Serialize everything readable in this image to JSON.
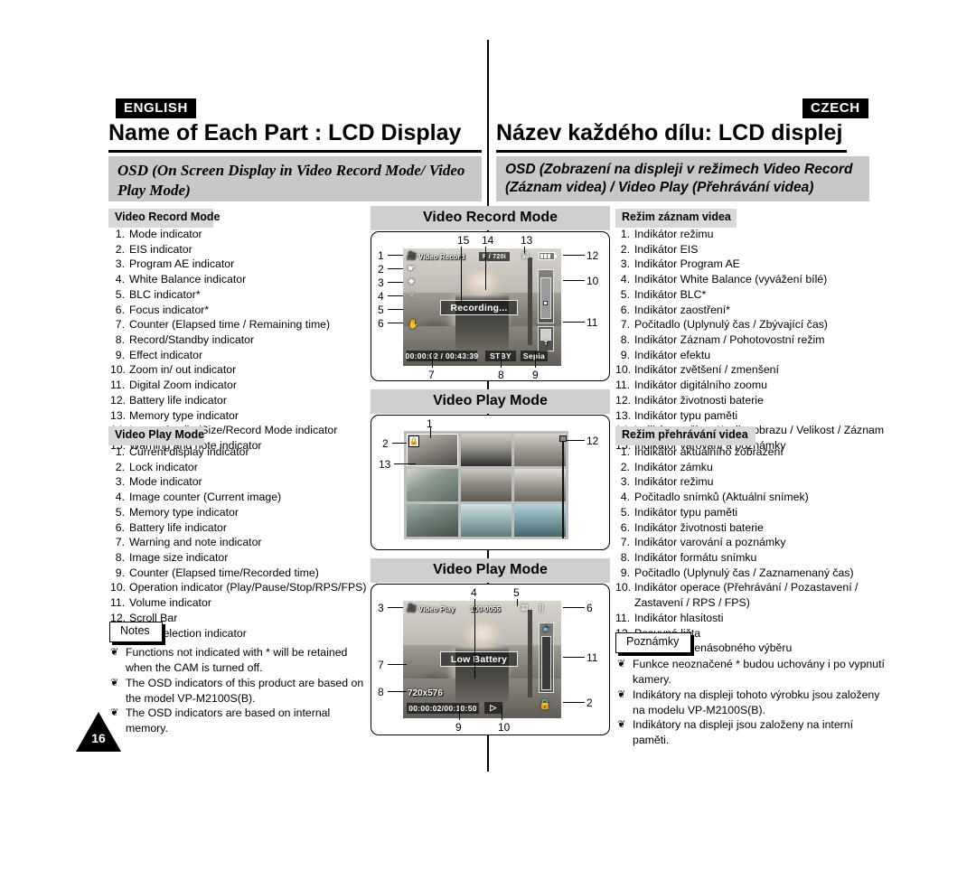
{
  "page": {
    "number": "16",
    "lang_left": "ENGLISH",
    "lang_right": "CZECH",
    "title_left": "Name of Each Part : LCD Display",
    "title_right": "Název každého dílu: LCD displej",
    "osd_subtitle_left": "OSD (On Screen Display in Video Record Mode/ Video Play Mode)",
    "osd_subtitle_right": "OSD (Zobrazení na displeji v režimech Video Record (Záznam videa) / Video Play (Přehrávání videa)"
  },
  "left": {
    "record_heading": "Video Record Mode",
    "record_items": [
      "Mode indicator",
      "EIS indicator",
      "Program AE indicator",
      "White Balance indicator",
      "BLC indicator*",
      "Focus indicator*",
      "Counter (Elapsed time / Remaining time)",
      "Record/Standby indicator",
      "Effect indicator",
      "Zoom in/ out indicator",
      "Digital Zoom indicator",
      "Battery life indicator",
      "Memory type indicator",
      "Image Quality/Size/Record Mode indicator",
      "Warning and note indicator"
    ],
    "play_heading": "Video Play Mode",
    "play_items": [
      "Current display indicator",
      "Lock indicator",
      "Mode indicator",
      "Image counter (Current image)",
      "Memory type indicator",
      "Battery life indicator",
      "Warning and note indicator",
      "Image size indicator",
      "Counter (Elapsed time/Recorded time)",
      "Operation indicator (Play/Pause/Stop/RPS/FPS)",
      "Volume indicator",
      "Scroll Bar",
      "Multi Selection indicator"
    ],
    "notes_label": "Notes",
    "notes": [
      "Functions not indicated with * will be retained when the CAM is turned off.",
      "The OSD indicators of this product are based on the model VP-M2100S(B).",
      "The OSD indicators are based on internal memory."
    ]
  },
  "right": {
    "record_heading": "Režim záznam videa",
    "record_items": [
      "Indikátor režimu",
      "Indikátor EIS",
      "Indikátor Program AE",
      "Indikátor White Balance (vyvážení bílé)",
      "Indikátor BLC*",
      "Indikátor zaostření*",
      "Počitadlo (Uplynulý čas / Zbývající čas)",
      "Indikátor Záznam / Pohotovostní režim",
      "Indikátor efektu",
      "Indikátor zvětšení / zmenšení",
      "Indikátor digitálního zoomu",
      "Indikátor životnosti baterie",
      "Indikátor typu paměti",
      "Indikátor režimu Kvalita obrazu / Velikost / Záznam",
      "Indikátor varování a poznámky"
    ],
    "play_heading": "Režim přehrávání videa",
    "play_items": [
      "Indikátor aktuálního zobrazení",
      "Indikátor zámku",
      "Indikátor režimu",
      "Počitadlo snímků (Aktuální snímek)",
      "Indikátor typu paměti",
      "Indikátor životnosti baterie",
      "Indikátor varování a poznámky",
      "Indikátor formátu snímku",
      "Počitadlo (Uplynulý čas / Zaznamenaný čas)",
      "Indikátor operace (Přehrávání / Pozastavení / Zastavení / RPS / FPS)",
      "Indikátor hlasitosti",
      "Posuvná lišta",
      "Indikátor vícenásobného výběru"
    ],
    "notes_label": "Poznámky",
    "notes": [
      "Funkce neoznačené * budou uchovány i po vypnutí kamery.",
      "Indikátory na displeji tohoto výrobku jsou založeny na modelu VP-M2100S(B).",
      "Indikátory na displeji jsou založeny na interní paměti."
    ]
  },
  "figures": {
    "fig1": {
      "heading": "Video Record Mode",
      "osd": {
        "mode_label": "Video Record",
        "quality_label": "F / 720i",
        "banner": "Recording...",
        "counter": "00:00:02 / 00:43:39",
        "standby": "STBY",
        "effect": "Sepia",
        "zoom_tele": "T"
      },
      "callouts": [
        "1",
        "2",
        "3",
        "4",
        "5",
        "6",
        "7",
        "8",
        "9",
        "10",
        "11",
        "12",
        "13",
        "14",
        "15"
      ]
    },
    "fig2": {
      "heading": "Video Play Mode",
      "callouts": [
        "1",
        "2",
        "12",
        "13"
      ]
    },
    "fig3": {
      "heading": "Video Play Mode",
      "osd": {
        "mode_label": "Video Play",
        "counter_images": "100-0055",
        "banner": "Low Battery",
        "size": "720x576",
        "counter": "00:00:02/00:10:50"
      },
      "callouts": [
        "2",
        "3",
        "4",
        "5",
        "6",
        "7",
        "8",
        "9",
        "10",
        "11"
      ]
    }
  },
  "icons": {
    "lock": "lock-icon",
    "camcorder": "camcorder-icon",
    "eis": "hand-shake-icon",
    "program_ae": "program-ae-icon",
    "white_balance": "white-balance-icon",
    "focus": "focus-hand-icon",
    "battery": "battery-icon",
    "memory": "memory-card-icon",
    "speaker": "speaker-icon",
    "play": "play-icon",
    "record_square": "record-square-icon",
    "note_bullet": "clover-bullet-icon"
  },
  "colors": {
    "band_gray": "#c8c8c8",
    "section_gray": "#d8d8d8",
    "figure_head_gray": "#cfcfcf",
    "ink": "#000000"
  }
}
